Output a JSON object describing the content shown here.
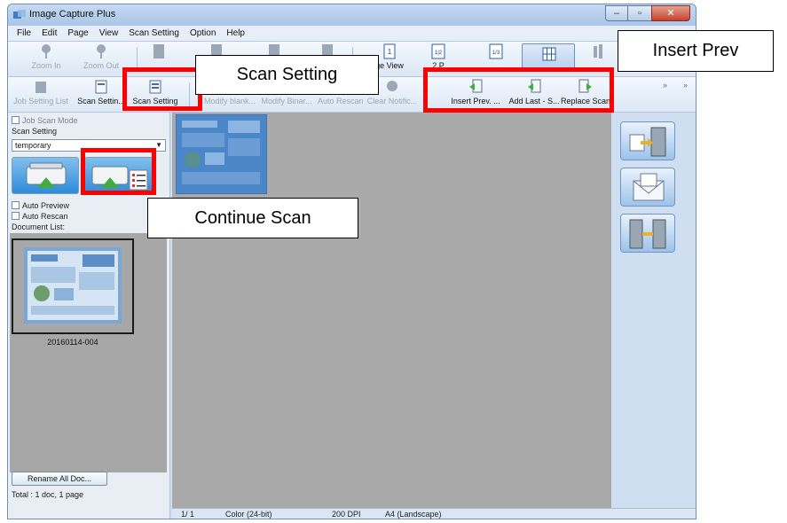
{
  "window": {
    "title": "Image Capture Plus"
  },
  "window_controls": {
    "minimize": "–",
    "maximize": "▫",
    "close": "✕"
  },
  "menu": [
    "File",
    "Edit",
    "Page",
    "View",
    "Scan Setting",
    "Option",
    "Help"
  ],
  "toolbar_top": {
    "zoom_in": "Zoom In",
    "zoom_out": "Zoom Out",
    "page_view": "ge View",
    "two_page_view": "2 P",
    "one_icon": "1",
    "two_icon": "1|2",
    "three_icon": "1/3"
  },
  "toolbar_bottom": {
    "job_setting_list": "Job Setting List",
    "scan_setting_list": "Scan Settin...",
    "scan_setting": "Scan Setting",
    "modify_blank": "Modify blank...",
    "modify_binar": "Modify Binar...",
    "auto_rescan": "Auto Rescan",
    "clear_notific": "Clear Notific...",
    "insert_prev": "Insert Prev. ...",
    "add_last": "Add Last - S...",
    "replace_scan": "Replace Scan",
    "more": "»"
  },
  "left_panel": {
    "job_scan_mode": "Job Scan Mode",
    "scan_setting_label": "Scan Setting",
    "scan_setting_value": "temporary",
    "auto_preview": "Auto Preview",
    "auto_rescan": "Auto Rescan",
    "document_list_label": "Document List:",
    "document_name": "20160114-004",
    "rename_button": "Rename All Doc...",
    "total": "Total :  1 doc,    1 page"
  },
  "status_bar": {
    "page": "1/  1",
    "color": "Color (24-bit)",
    "dpi": "200 DPI",
    "paper": "A4 (Landscape)"
  },
  "callouts": {
    "scan_setting": "Scan Setting",
    "continue_scan": "Continue Scan",
    "insert_prev": "Insert Prev"
  },
  "colors": {
    "highlight": "#ff0000",
    "window_frame": "#6f8fb4",
    "workspace": "#a9a9a9",
    "thumbnail_blue": "#4a86c8"
  }
}
